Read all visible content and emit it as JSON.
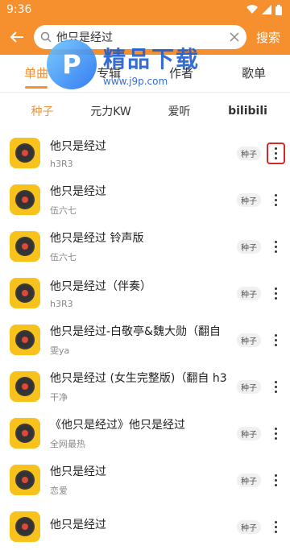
{
  "status": {
    "time": "9:36"
  },
  "search": {
    "query": "他只是经过",
    "button_label": "搜索"
  },
  "tabs": [
    {
      "label": "单曲",
      "active": true
    },
    {
      "label": "专辑",
      "active": false
    },
    {
      "label": "作者",
      "active": false
    },
    {
      "label": "歌单",
      "active": false
    }
  ],
  "watermark": {
    "title": "精品下载",
    "url": "www.j9p.com"
  },
  "sources": [
    {
      "label": "种子",
      "active": true
    },
    {
      "label": "元力KW",
      "active": false
    },
    {
      "label": "爱听",
      "active": false
    },
    {
      "label": "bilibili",
      "active": false
    }
  ],
  "songs": [
    {
      "title": "他只是经过",
      "artist": "h3R3",
      "badge": "种子"
    },
    {
      "title": " 他只是经过",
      "artist": "伍六七",
      "badge": "种子"
    },
    {
      "title": "他只是经过 铃声版",
      "artist": "伍六七",
      "badge": "种子"
    },
    {
      "title": "他只是经过（伴奏）",
      "artist": "h3R3",
      "badge": "种子"
    },
    {
      "title": "他只是经过-白敬亭&魏大勋（翻自",
      "artist": "雯ya",
      "badge": "种子"
    },
    {
      "title": "他只是经过 (女生完整版)（翻自 h3",
      "artist": "干净",
      "badge": "种子"
    },
    {
      "title": "《他只是经过》他只是经过",
      "artist": "全网最热",
      "badge": "种子"
    },
    {
      "title": "他只是经过",
      "artist": "恋爱",
      "badge": "种子"
    },
    {
      "title": "他只是经过",
      "artist": "",
      "badge": "种子"
    }
  ],
  "colors": {
    "accent": "#f6902f",
    "highlight": "#d02a2a",
    "cover": "#f7c21c"
  }
}
